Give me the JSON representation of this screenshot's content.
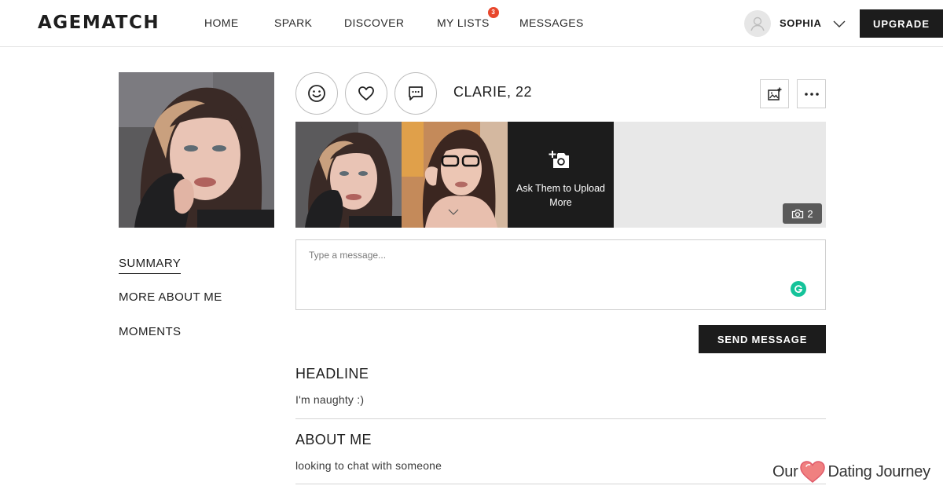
{
  "header": {
    "logo": "AGEMATCH",
    "nav": [
      {
        "label": "HOME"
      },
      {
        "label": "SPARK"
      },
      {
        "label": "DISCOVER"
      },
      {
        "label": "MY LISTS",
        "badge": "3"
      },
      {
        "label": "MESSAGES"
      }
    ],
    "user": {
      "name": "SOPHIA",
      "avatar_icon": "user-silhouette-icon"
    },
    "upgrade_label": "UPGRADE"
  },
  "sidebar": {
    "links": [
      {
        "label": "SUMMARY",
        "active": true
      },
      {
        "label": "MORE ABOUT ME"
      },
      {
        "label": "MOMENTS"
      }
    ]
  },
  "profile": {
    "name_age": "CLARIE, 22",
    "actions": [
      "smile-icon",
      "heart-icon",
      "chat-bubble-icon"
    ],
    "tools": [
      "image-add-icon",
      "more-dots-icon"
    ]
  },
  "photos": {
    "ask_label": "Ask Them to Upload More",
    "count": "2"
  },
  "message": {
    "placeholder": "Type a message...",
    "send_label": "SEND MESSAGE"
  },
  "sections": {
    "headline": {
      "title": "HEADLINE",
      "body": "I'm naughty :)"
    },
    "about": {
      "title": "ABOUT ME",
      "body": "looking to chat with someone"
    }
  },
  "watermark": {
    "left": "Our",
    "right": "Dating Journey"
  },
  "colors": {
    "accent_dark": "#1c1c1c",
    "badge": "#e8472c",
    "grammarly": "#15c39a",
    "heart": "#f08080"
  }
}
